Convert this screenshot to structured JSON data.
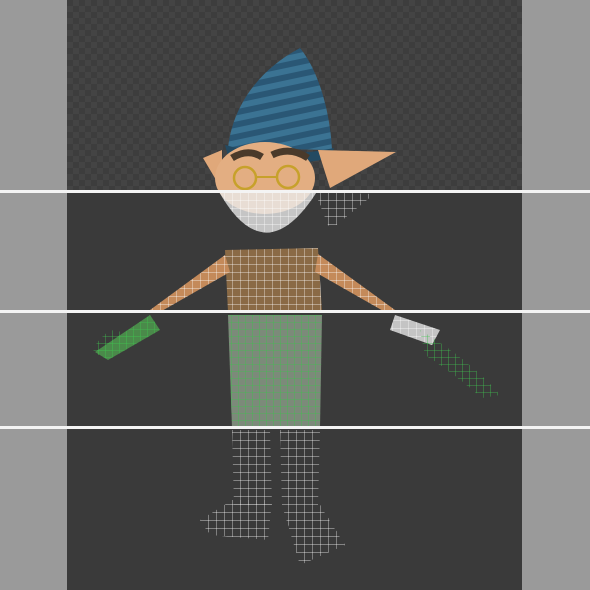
{
  "scene": {
    "subject": "gnome-character-wireframe-breakdown",
    "colors": {
      "side_gray": "#9a9a9a",
      "viewport_dark": "#3a3a3a",
      "divider_white": "#f4f4f4",
      "hat_blue": "#2d5b78",
      "skin": "#e0a87a",
      "wire_white": "#ffffff",
      "wire_green": "#3fbf4f"
    }
  }
}
